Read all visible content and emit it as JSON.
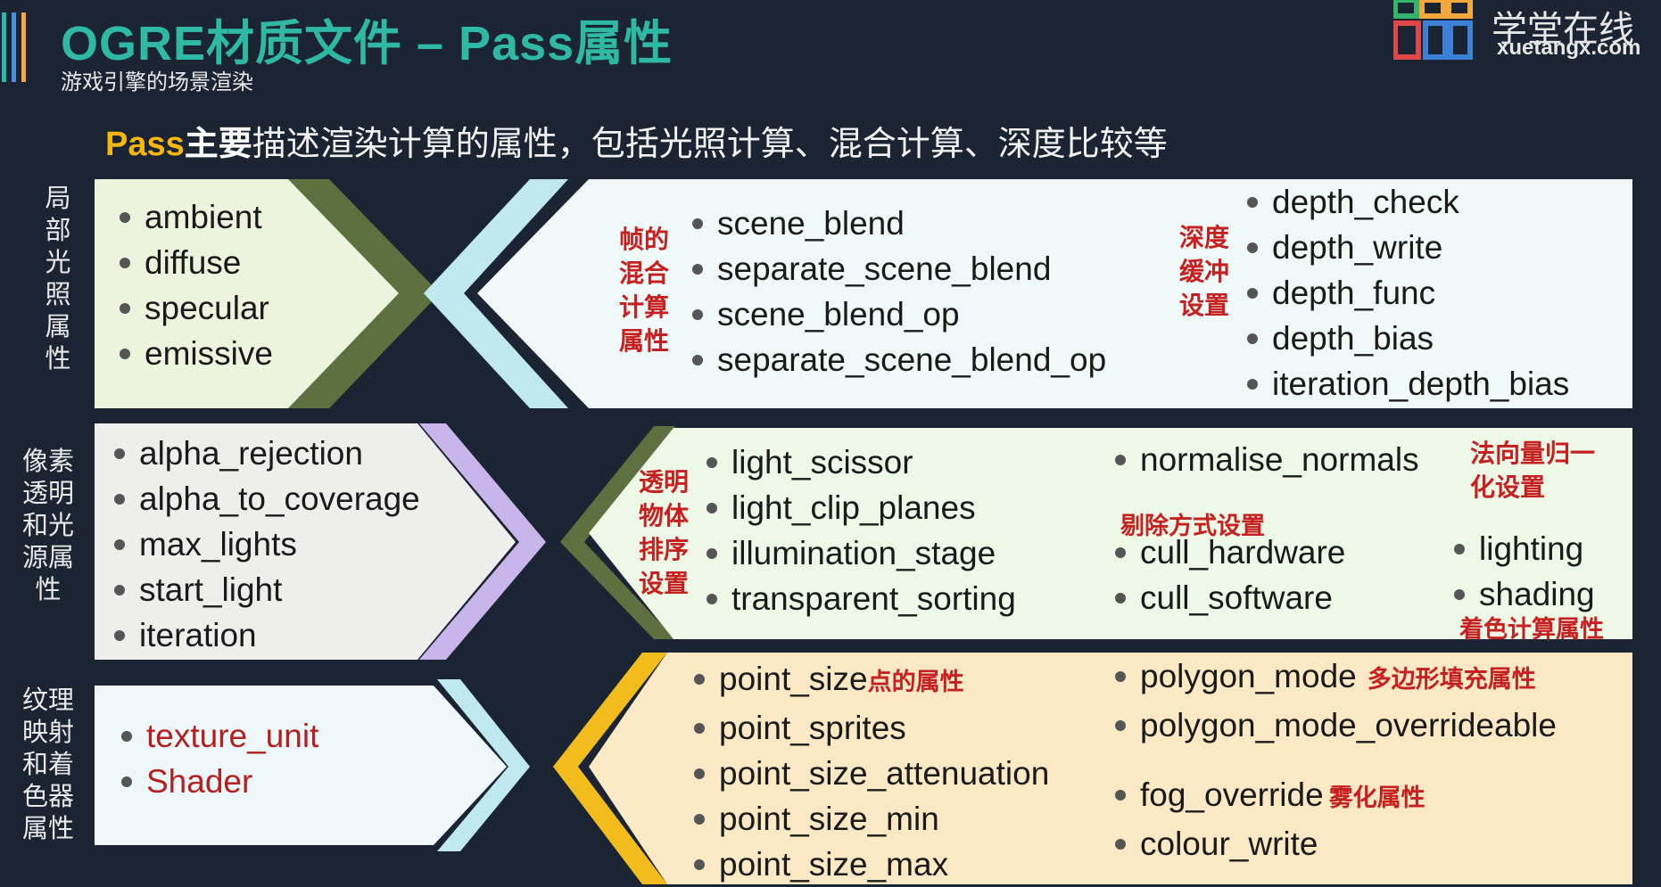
{
  "header": {
    "title": "OGRE材质文件 – Pass属性",
    "subtitle": "游戏引擎的场景渲染",
    "logo_cn": "学堂在线",
    "logo_en": "xuetangx.com"
  },
  "intro": {
    "part1": "Pass",
    "part2": "主要",
    "part3": "描述渲染计算的属性，包括光照计算、混合计算、深度比较等"
  },
  "rows": {
    "lighting": {
      "side_label": "局部光照属性",
      "items": [
        "ambient",
        "diffuse",
        "specular",
        "emissive"
      ],
      "blend_note": "帧的混合计算属性",
      "blend_items": [
        "scene_blend",
        "separate_scene_blend",
        "scene_blend_op",
        "separate_scene_blend_op"
      ],
      "depth_note": "深度缓冲设置",
      "depth_items": [
        "depth_check",
        "depth_write",
        "depth_func",
        "depth_bias",
        "iteration_depth_bias"
      ]
    },
    "pixel": {
      "side_label": "像素透明和光源属性",
      "items": [
        "alpha_rejection",
        "alpha_to_coverage",
        "max_lights",
        "start_light",
        "iteration"
      ],
      "sort_note": "透明物体排序设置",
      "sort_items": [
        "light_scissor",
        "light_clip_planes",
        "illumination_stage",
        "transparent_sorting"
      ],
      "normal_item": "normalise_normals",
      "normal_note": "法向量归一化设置",
      "cull_note": "剔除方式设置",
      "cull_items": [
        "cull_hardware",
        "cull_software"
      ],
      "shade_items": [
        "lighting",
        "shading"
      ],
      "shade_note": "着色计算属性"
    },
    "texture": {
      "side_label": "纹理映射和着色器属性",
      "items": [
        "texture_unit",
        "Shader"
      ],
      "point_items": [
        "point_size",
        "point_sprites",
        "point_size_attenuation",
        "point_size_min",
        "point_size_max"
      ],
      "point_note": "点的属性",
      "poly_items": [
        "polygon_mode",
        "polygon_mode_overrideable"
      ],
      "poly_note": "多边形填充属性",
      "fog_items": [
        "fog_override",
        "colour_write"
      ],
      "fog_note": "雾化属性"
    }
  },
  "colors": {
    "background": "#1b2432",
    "title": "#2fb8a3",
    "highlight": "#f5b70c",
    "note_red": "#c62020"
  }
}
